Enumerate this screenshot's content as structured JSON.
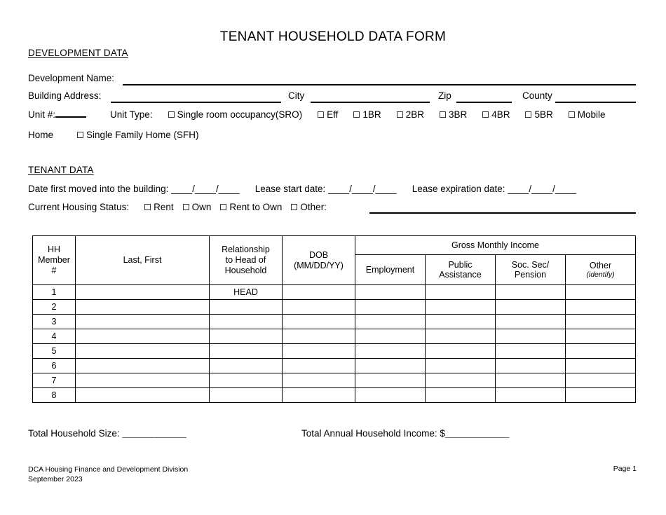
{
  "document": {
    "title": "TENANT HOUSEHOLD DATA FORM"
  },
  "development_section": {
    "heading": "DEVELOPMENT DATA",
    "development_name_label": "Development Name:",
    "building_address_label": "Building Address:",
    "city_label": "City",
    "zip_label": "Zip",
    "county_label": "County",
    "unit_number_label": "Unit #:",
    "unit_type_label": "Unit Type:",
    "unit_type_options": [
      "Single room occupancy(SRO)",
      "Eff",
      "1BR",
      "2BR",
      "3BR",
      "4BR",
      "5BR",
      "Mobile Home",
      "Single Family Home (SFH)"
    ],
    "mobile_home_wrap_first": "Mobile",
    "mobile_home_wrap_second": "Home",
    "sfh_option": "Single Family Home (SFH)"
  },
  "tenant_section": {
    "heading": "TENANT DATA",
    "date_moved_in_label": "Date first moved into the building:",
    "lease_start_label": "Lease start date:",
    "lease_expiration_label": "Lease expiration date:",
    "date_placeholder": "____/____/____",
    "housing_status_label": "Current Housing Status:",
    "housing_status_options": [
      "Rent",
      "Own",
      "Rent to Own",
      "Other:"
    ]
  },
  "household_table": {
    "columns": {
      "hh_member": "HH Member #",
      "hh_member_line1": "HH",
      "hh_member_line2": "Member",
      "hh_member_line3": "#",
      "name": "Last, First",
      "relationship_line1": "Relationship",
      "relationship_line2": "to Head of",
      "relationship_line3": "Household",
      "dob_line1": "DOB",
      "dob_line2": "(MM/DD/YY)",
      "gross_monthly_income": "Gross Monthly Income",
      "employment": "Employment",
      "public_assistance_line1": "Public",
      "public_assistance_line2": "Assistance",
      "soc_sec_line1": "Soc. Sec/",
      "soc_sec_line2": "Pension",
      "other": "Other",
      "other_note": "(identify)"
    },
    "rows": [
      {
        "number": "1",
        "name": "",
        "relationship": "HEAD",
        "dob": "",
        "employment": "",
        "public_assistance": "",
        "soc_sec_pension": "",
        "other": ""
      },
      {
        "number": "2",
        "name": "",
        "relationship": "",
        "dob": "",
        "employment": "",
        "public_assistance": "",
        "soc_sec_pension": "",
        "other": ""
      },
      {
        "number": "3",
        "name": "",
        "relationship": "",
        "dob": "",
        "employment": "",
        "public_assistance": "",
        "soc_sec_pension": "",
        "other": ""
      },
      {
        "number": "4",
        "name": "",
        "relationship": "",
        "dob": "",
        "employment": "",
        "public_assistance": "",
        "soc_sec_pension": "",
        "other": ""
      },
      {
        "number": "5",
        "name": "",
        "relationship": "",
        "dob": "",
        "employment": "",
        "public_assistance": "",
        "soc_sec_pension": "",
        "other": ""
      },
      {
        "number": "6",
        "name": "",
        "relationship": "",
        "dob": "",
        "employment": "",
        "public_assistance": "",
        "soc_sec_pension": "",
        "other": ""
      },
      {
        "number": "7",
        "name": "",
        "relationship": "",
        "dob": "",
        "employment": "",
        "public_assistance": "",
        "soc_sec_pension": "",
        "other": ""
      },
      {
        "number": "8",
        "name": "",
        "relationship": "",
        "dob": "",
        "employment": "",
        "public_assistance": "",
        "soc_sec_pension": "",
        "other": ""
      }
    ]
  },
  "totals": {
    "household_size_label": "Total Household Size:",
    "household_size_blank": "_____________",
    "annual_income_label": "Total Annual Household Income:",
    "annual_income_currency": "$",
    "annual_income_blank": "_____________"
  },
  "footer": {
    "org_line": "DCA Housing Finance and Development Division",
    "date_line": "September 2023",
    "page_label": "Page 1"
  }
}
